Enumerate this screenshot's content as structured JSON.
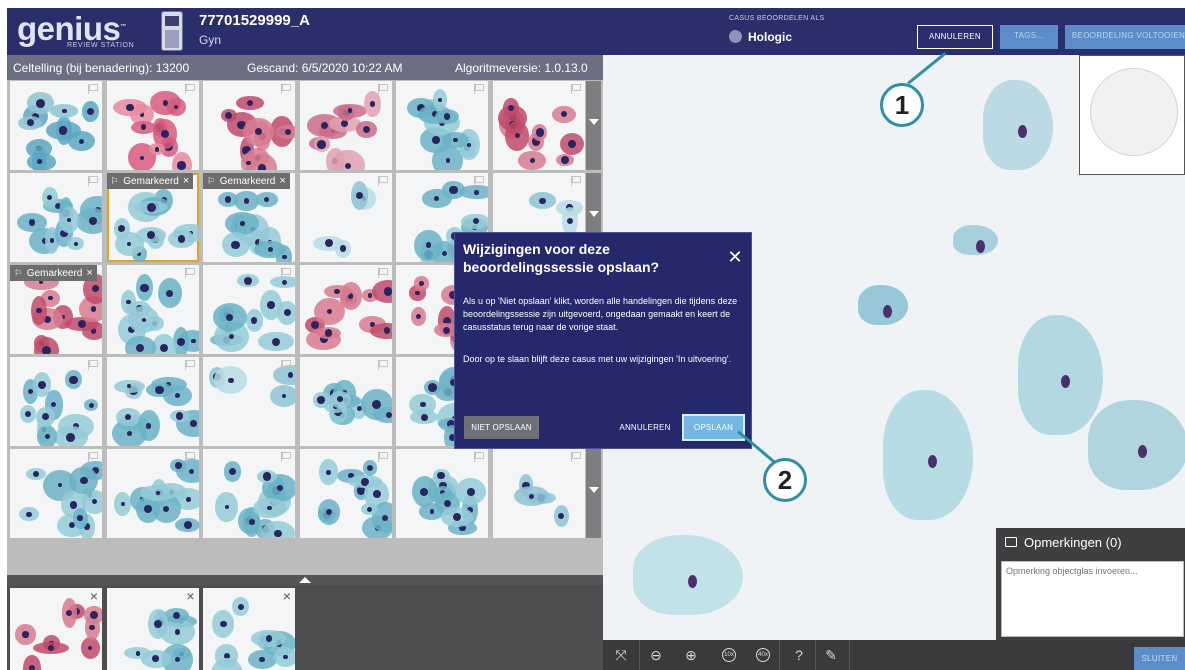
{
  "header": {
    "logo": "genius",
    "logo_tm": "™",
    "logo_sub": "REVIEW STATION",
    "case_id": "77701529999_A",
    "case_type": "Gyn",
    "reviewer_caption": "CASUS BEOORDELEN ALS",
    "reviewer_name": "Hologic",
    "buttons": {
      "cancel": "ANNULEREN",
      "tags": "TAGS...",
      "complete": "BEOORDELING VOLTOOIEN"
    }
  },
  "info_bar": {
    "cell_count": "Celtelling (bij benadering): 13200",
    "scanned": "Gescand: 6/5/2020 10:22 AM",
    "algorithm": "Algoritmeversie: 1.0.13.0"
  },
  "gallery": {
    "flag_label": "Gemarkeerd",
    "flag_close": "×",
    "rows": 5,
    "per_row": 6
  },
  "bottom_strip": {
    "close": "×",
    "count": 3
  },
  "viewer": {
    "toolbar": {
      "fit": "fit-to-screen-icon",
      "zoom_out": "zoom-out-icon",
      "zoom_in": "zoom-in-icon",
      "zoom_10": "10x",
      "zoom_40": "40x",
      "help": "?",
      "pen": "pen-icon"
    },
    "close_button": "SLUITEN"
  },
  "comments": {
    "title": "Opmerkingen (0)",
    "placeholder": "Opmerking objectglas invoeren..."
  },
  "dialog": {
    "title": "Wijzigingen voor deze beoordelingssessie opslaan?",
    "close": "✕",
    "paragraph1": "Als u op 'Niet opslaan' klikt, worden alle handelingen die tijdens deze beoordelingssessie zijn uitgevoerd, ongedaan gemaakt en keert de casusstatus terug naar de vorige staat.",
    "paragraph2": "Door op te slaan blijft deze casus met uw wijzigingen 'In uitvoering'.",
    "btn_dont_save": "NIET OPSLAAN",
    "btn_cancel": "ANNULEREN",
    "btn_save": "OPSLAAN"
  },
  "callouts": {
    "one": "1",
    "two": "2"
  },
  "colors": {
    "header_bg": "#2a2e6b",
    "dialog_bg": "#25296b",
    "accent_blue": "#5d8dc8",
    "save_button": "#74b7e4",
    "callout_teal": "#2f8fa6",
    "selection_gold": "#e0a51c"
  }
}
